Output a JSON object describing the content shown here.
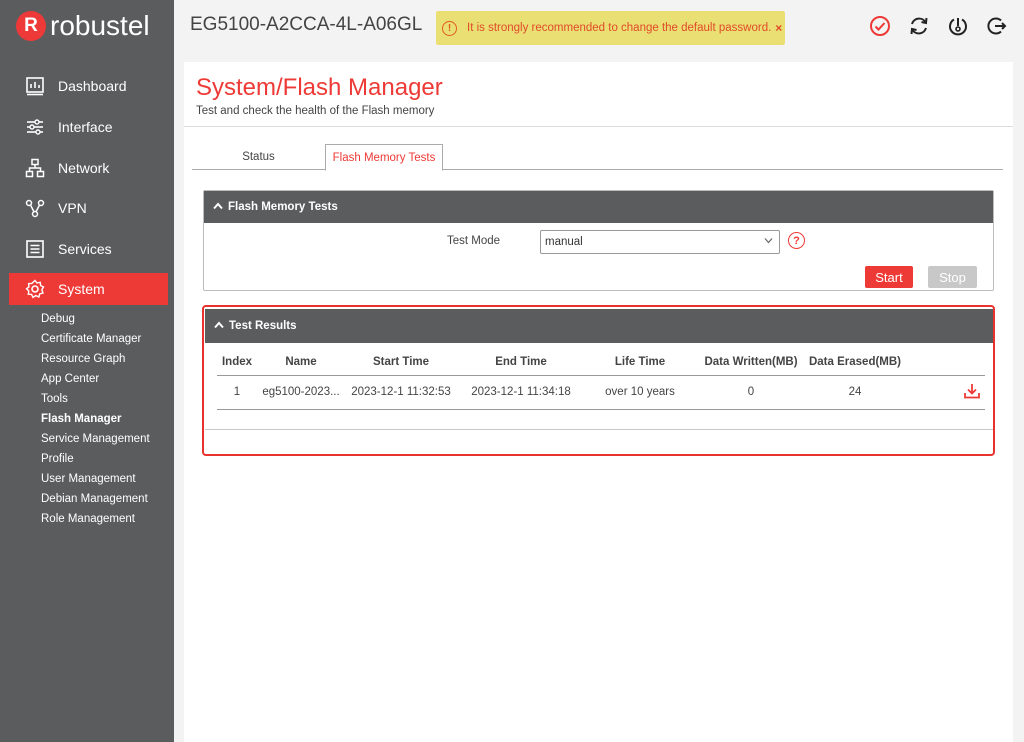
{
  "brand": {
    "logo_mark": "R",
    "logo_text": "robustel",
    "device_title": "EG5100-A2CCA-4L-A06GL"
  },
  "warning": {
    "text": "It is strongly recommended to change the default password.",
    "close": "×"
  },
  "header_icons": [
    "check-circle-icon",
    "refresh-icon",
    "reboot-icon",
    "logout-icon"
  ],
  "sidebar": {
    "items": [
      {
        "label": "Dashboard",
        "icon": "dashboard-icon"
      },
      {
        "label": "Interface",
        "icon": "sliders-icon"
      },
      {
        "label": "Network",
        "icon": "network-icon"
      },
      {
        "label": "VPN",
        "icon": "vpn-icon"
      },
      {
        "label": "Services",
        "icon": "services-icon"
      },
      {
        "label": "System",
        "icon": "gear-icon",
        "active": true
      }
    ],
    "sub_items": [
      "Debug",
      "Certificate Manager",
      "Resource Graph",
      "App Center",
      "Tools",
      "Flash Manager",
      "Service Management",
      "Profile",
      "User Management",
      "Debian Management",
      "Role Management"
    ],
    "current_sub": "Flash Manager"
  },
  "page": {
    "title": "System/Flash Manager",
    "subtitle": "Test and check the health of the Flash memory"
  },
  "tabs": [
    {
      "label": "Status"
    },
    {
      "label": "Flash Memory Tests",
      "active": true
    }
  ],
  "tests_panel": {
    "title": "Flash Memory Tests",
    "test_mode_label": "Test Mode",
    "test_mode_value": "manual",
    "start_label": "Start",
    "stop_label": "Stop"
  },
  "results_panel": {
    "title": "Test Results",
    "columns": [
      "Index",
      "Name",
      "Start Time",
      "End Time",
      "Life Time",
      "Data Written(MB)",
      "Data Erased(MB)"
    ],
    "rows": [
      [
        "1",
        "eg5100-2023...",
        "2023-12-1 11:32:53",
        "2023-12-1 11:34:18",
        "over 10 years",
        "0",
        "24"
      ]
    ]
  },
  "colors": {
    "accent": "#ee3a36",
    "sidebar": "#5b5c5e",
    "warning_bg": "#e9df73"
  }
}
